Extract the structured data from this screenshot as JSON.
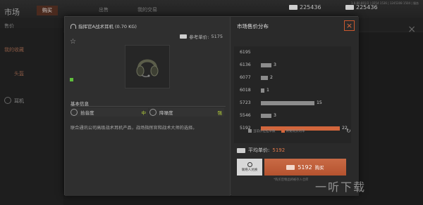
{
  "background": {
    "title": "市场",
    "tabs": [
      "购买",
      "出售",
      "我的交易"
    ],
    "active_tab_index": 0,
    "currency1": "225436",
    "currency2": "225436",
    "version_text": "1.0.80.801/2 | 0254 1536 | 1245308 1504 | 服务",
    "sort_label": "售价",
    "sidebar": [
      "我的收藏",
      "头盔",
      "耳机"
    ]
  },
  "item": {
    "name": "指挥官A战术耳机 (0.70 KG)",
    "reference_price_label": "参考单价:",
    "reference_price_value": "5175",
    "info_title": "基本信息",
    "stats": [
      {
        "label": "拾音度",
        "level": "中"
      },
      {
        "label": "降噪度",
        "level": "强"
      }
    ],
    "description": "联合通讯公司高级战术耳机产品，战场指挥官和战术大师的选择。"
  },
  "distribution": {
    "title": "市场售价分布",
    "close_icon": "×",
    "legend": [
      {
        "label": "当前价位挂单数",
        "color": "#8c8c8c"
      },
      {
        "label": "将要购买的单",
        "color": "#d2663c"
      }
    ]
  },
  "chart_data": {
    "type": "bar",
    "orientation": "horizontal",
    "categories": [
      "6195",
      "6136",
      "6077",
      "6018",
      "5723",
      "5546",
      "5192"
    ],
    "values": [
      0,
      3,
      2,
      1,
      15,
      3,
      22
    ],
    "highlight_category": "5192"
  },
  "purchase": {
    "avg_label": "平均单价:",
    "avg_value": "5192",
    "contact_label": "联络人兑换",
    "buy_price": "5192",
    "buy_label": "购买",
    "footnote": "*购买后物品将被存入仓库"
  },
  "watermark": "一听下载"
}
